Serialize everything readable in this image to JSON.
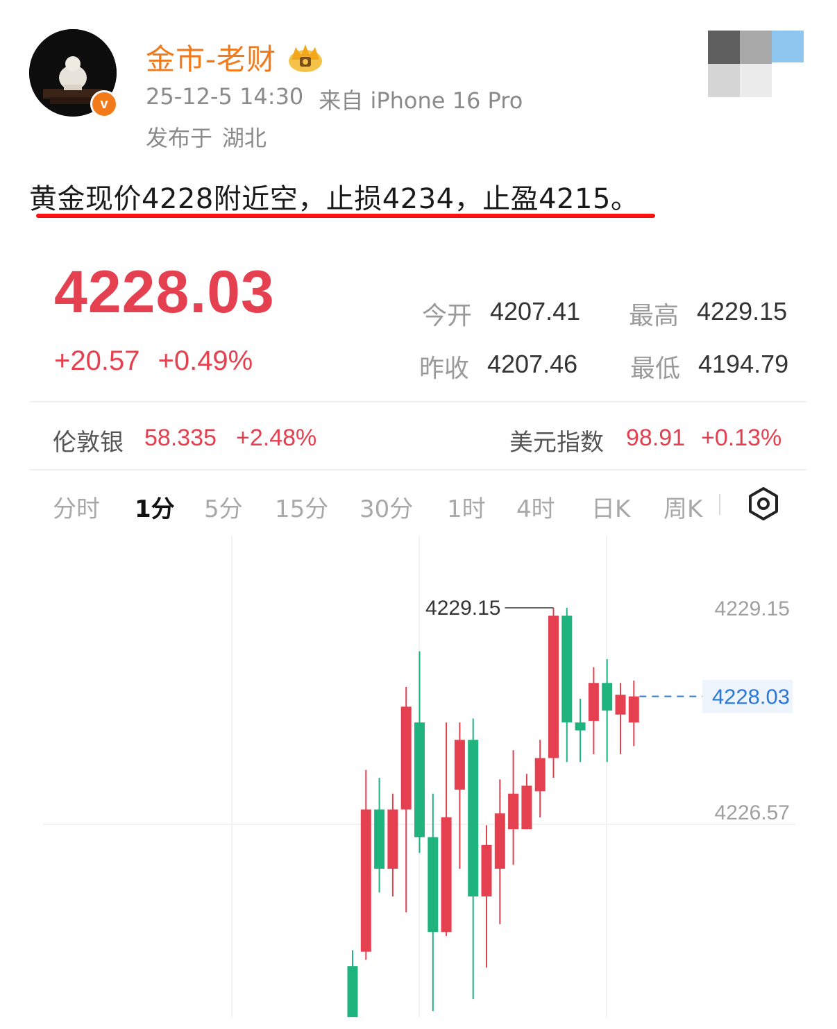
{
  "post": {
    "author": "金市-老财",
    "timestamp": "25-12-5 14:30",
    "source": "来自 iPhone 16 Pro",
    "location_prefix": "发布于",
    "location": "湖北",
    "text": "黄金现价4228附近空，止损4234，止盈4215。",
    "verified_badge": "v"
  },
  "quote": {
    "price": "4228.03",
    "change": "+20.57",
    "change_pct": "+0.49%",
    "stats": [
      {
        "label": "今开",
        "value": "4207.41"
      },
      {
        "label": "最高",
        "value": "4229.15"
      },
      {
        "label": "昨收",
        "value": "4207.46"
      },
      {
        "label": "最低",
        "value": "4194.79"
      }
    ],
    "refs": [
      {
        "label": "伦敦银",
        "value": "58.335",
        "change": "+2.48%"
      },
      {
        "label": "美元指数",
        "value": "98.91",
        "change": "+0.13%"
      }
    ],
    "tabs": [
      "分时",
      "1分",
      "5分",
      "15分",
      "30分",
      "1时",
      "4时",
      "日K",
      "周K"
    ],
    "active_tab": "1分"
  },
  "colors": {
    "brand": "#f27a1a",
    "up": "#e5404f",
    "down": "#1fb37d",
    "current_price": "#2c78d6",
    "highlight": "#ff1010"
  },
  "chart_data": {
    "type": "candlestick",
    "y_ticks": [
      "4229.15",
      "4228.03",
      "4226.57"
    ],
    "high_label": "4229.15",
    "current_label": "4228.03",
    "candles": [
      {
        "open": 4224.62,
        "close": 4223.72,
        "high": 4224.82,
        "low": 4223.72
      },
      {
        "open": 4224.8,
        "close": 4226.6,
        "high": 4227.1,
        "low": 4224.7
      },
      {
        "open": 4226.6,
        "close": 4225.85,
        "high": 4227.0,
        "low": 4225.55
      },
      {
        "open": 4225.85,
        "close": 4226.6,
        "high": 4226.8,
        "low": 4225.5
      },
      {
        "open": 4226.6,
        "close": 4227.9,
        "high": 4228.15,
        "low": 4225.3
      },
      {
        "open": 4227.7,
        "close": 4226.25,
        "high": 4228.6,
        "low": 4226.05
      },
      {
        "open": 4226.25,
        "close": 4225.05,
        "high": 4226.8,
        "low": 4224.05
      },
      {
        "open": 4225.05,
        "close": 4226.5,
        "high": 4227.7,
        "low": 4225.0
      },
      {
        "open": 4226.85,
        "close": 4227.48,
        "high": 4227.7,
        "low": 4225.85
      },
      {
        "open": 4227.48,
        "close": 4225.5,
        "high": 4227.75,
        "low": 4224.2
      },
      {
        "open": 4225.5,
        "close": 4226.15,
        "high": 4226.4,
        "low": 4224.6
      },
      {
        "open": 4225.85,
        "close": 4226.55,
        "high": 4226.98,
        "low": 4225.15
      },
      {
        "open": 4226.35,
        "close": 4226.8,
        "high": 4227.35,
        "low": 4225.9
      },
      {
        "open": 4226.35,
        "close": 4226.9,
        "high": 4227.05,
        "low": 4226.35
      },
      {
        "open": 4226.83,
        "close": 4227.25,
        "high": 4227.48,
        "low": 4226.5
      },
      {
        "open": 4227.25,
        "close": 4229.05,
        "high": 4229.15,
        "low": 4227.0
      },
      {
        "open": 4229.05,
        "close": 4227.7,
        "high": 4229.15,
        "low": 4227.2
      },
      {
        "open": 4227.7,
        "close": 4227.6,
        "high": 4228.0,
        "low": 4227.2
      },
      {
        "open": 4227.72,
        "close": 4228.2,
        "high": 4228.4,
        "low": 4227.3
      },
      {
        "open": 4228.2,
        "close": 4227.85,
        "high": 4228.5,
        "low": 4227.2
      },
      {
        "open": 4227.8,
        "close": 4228.05,
        "high": 4228.2,
        "low": 4227.3
      },
      {
        "open": 4227.7,
        "close": 4228.03,
        "high": 4228.23,
        "low": 4227.4
      }
    ]
  }
}
